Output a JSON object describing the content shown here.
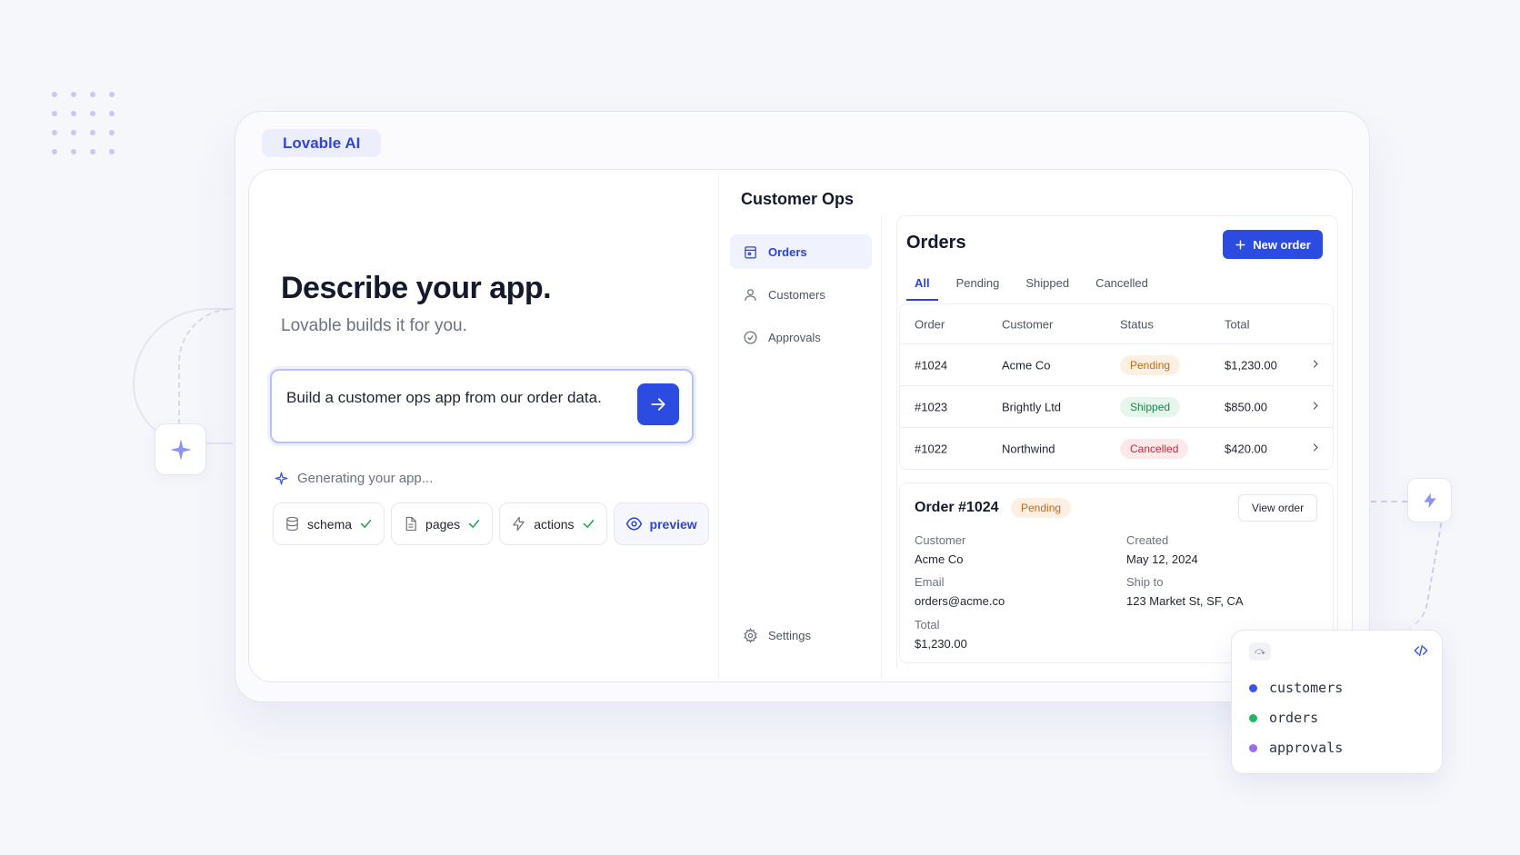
{
  "brand": {
    "badge": "Lovable AI"
  },
  "hero": {
    "title": "Describe your app.",
    "subtitle": "Lovable builds it for you.",
    "prompt_text": "Build a customer ops app from our order data.",
    "generating": "Generating your app...",
    "chips": [
      {
        "label": "schema",
        "icon": "database-icon",
        "done": true
      },
      {
        "label": "pages",
        "icon": "file-icon",
        "done": true
      },
      {
        "label": "actions",
        "icon": "bolt-icon",
        "done": true
      },
      {
        "label": "preview",
        "icon": "eye-icon",
        "done": false
      }
    ]
  },
  "app": {
    "title": "Customer Ops",
    "sidebar": {
      "items": [
        {
          "label": "Orders",
          "icon": "calendar-icon"
        },
        {
          "label": "Customers",
          "icon": "user-icon"
        },
        {
          "label": "Approvals",
          "icon": "check-circle-icon"
        }
      ],
      "settings": "Settings"
    },
    "orders": {
      "heading": "Orders",
      "new_order": "New order",
      "tabs": [
        "All",
        "Pending",
        "Shipped",
        "Cancelled"
      ],
      "columns": [
        "Order",
        "Customer",
        "Status",
        "Total"
      ],
      "rows": [
        {
          "order": "#1024",
          "customer": "Acme Co",
          "status": "Pending",
          "total": "$1,230.00"
        },
        {
          "order": "#1023",
          "customer": "Brightly Ltd",
          "status": "Shipped",
          "total": "$850.00"
        },
        {
          "order": "#1022",
          "customer": "Northwind",
          "status": "Cancelled",
          "total": "$420.00"
        }
      ]
    },
    "detail": {
      "title": "Order #1024",
      "status": "Pending",
      "view_button": "View order",
      "customer_label": "Customer",
      "customer": "Acme Co",
      "created_label": "Created",
      "created": "May 12, 2024",
      "email_label": "Email",
      "email": "orders@acme.co",
      "ship_label": "Ship to",
      "ship": "123 Market St, SF, CA",
      "total_label": "Total",
      "total": "$1,230.00"
    }
  },
  "schema_card": {
    "tag": "⤼",
    "tables": [
      {
        "name": "customers",
        "color": "#3b55e6"
      },
      {
        "name": "orders",
        "color": "#22b55f"
      },
      {
        "name": "approvals",
        "color": "#9a6cf0"
      }
    ]
  },
  "colors": {
    "accent": "#2c4be0",
    "pending": "#c26a12",
    "shipped": "#18864a",
    "cancelled": "#c5283d"
  }
}
